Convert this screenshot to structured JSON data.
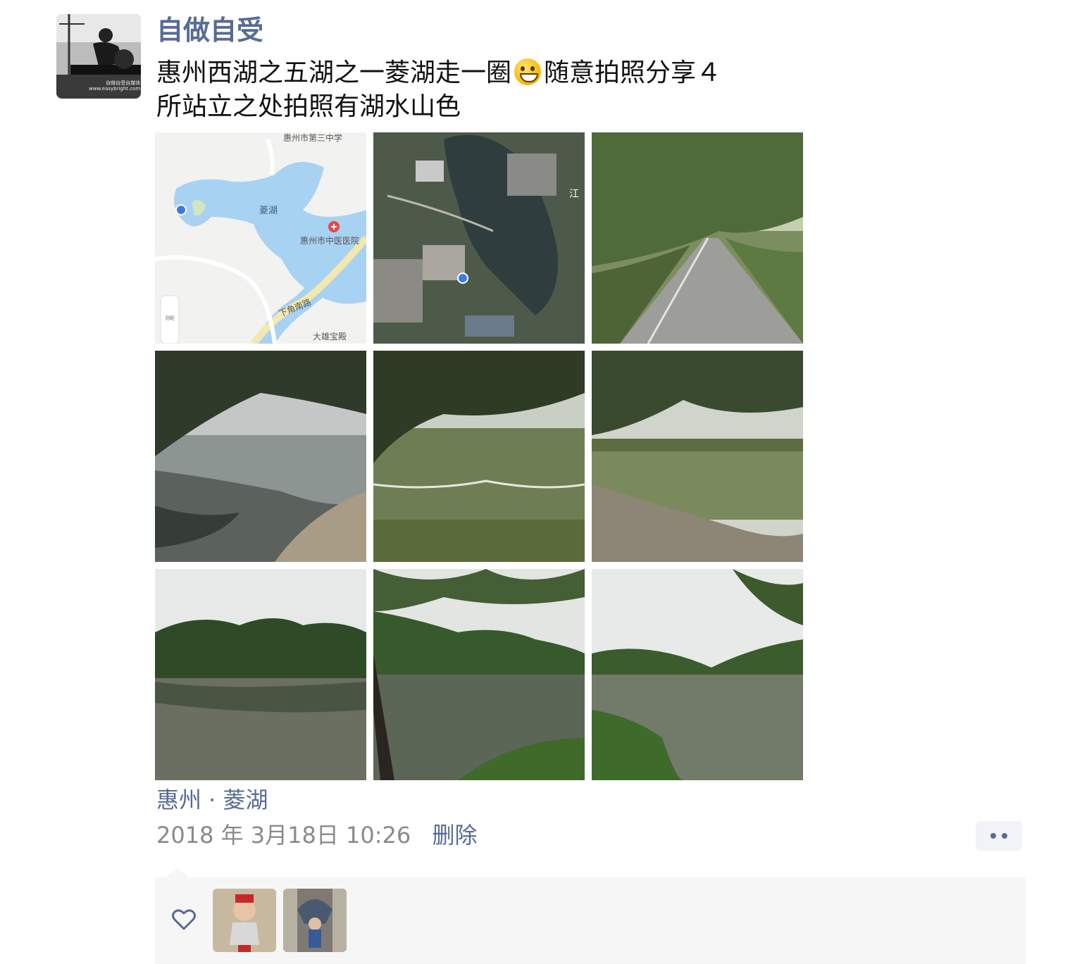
{
  "post": {
    "username": "自做自受",
    "avatar_caption_1": "自做自受自媒体",
    "avatar_caption_2": "www.easybright.com",
    "text_line1_before_emoji": "惠州西湖之五湖之一菱湖走一圈",
    "emoji": "grinning-face",
    "text_line1_after_emoji": "随意拍照分享４",
    "text_line2": "所站立之处拍照有湖水山色",
    "map_labels": {
      "school": "惠州市第三中学",
      "lake": "菱湖",
      "hospital": "惠州市中医医院",
      "road": "下角南路",
      "temple": "大雄宝殿",
      "zoom": "测距"
    },
    "satellite_label": "江",
    "location": "惠州 · 菱湖",
    "timestamp": "2018 年 3月18日 10:26",
    "delete_label": "删除"
  },
  "colors": {
    "link": "#576b95",
    "timestamp": "#8a8a8a",
    "likes_bg": "#f6f6f6"
  },
  "icons": [
    "heart-icon",
    "more-icon"
  ]
}
